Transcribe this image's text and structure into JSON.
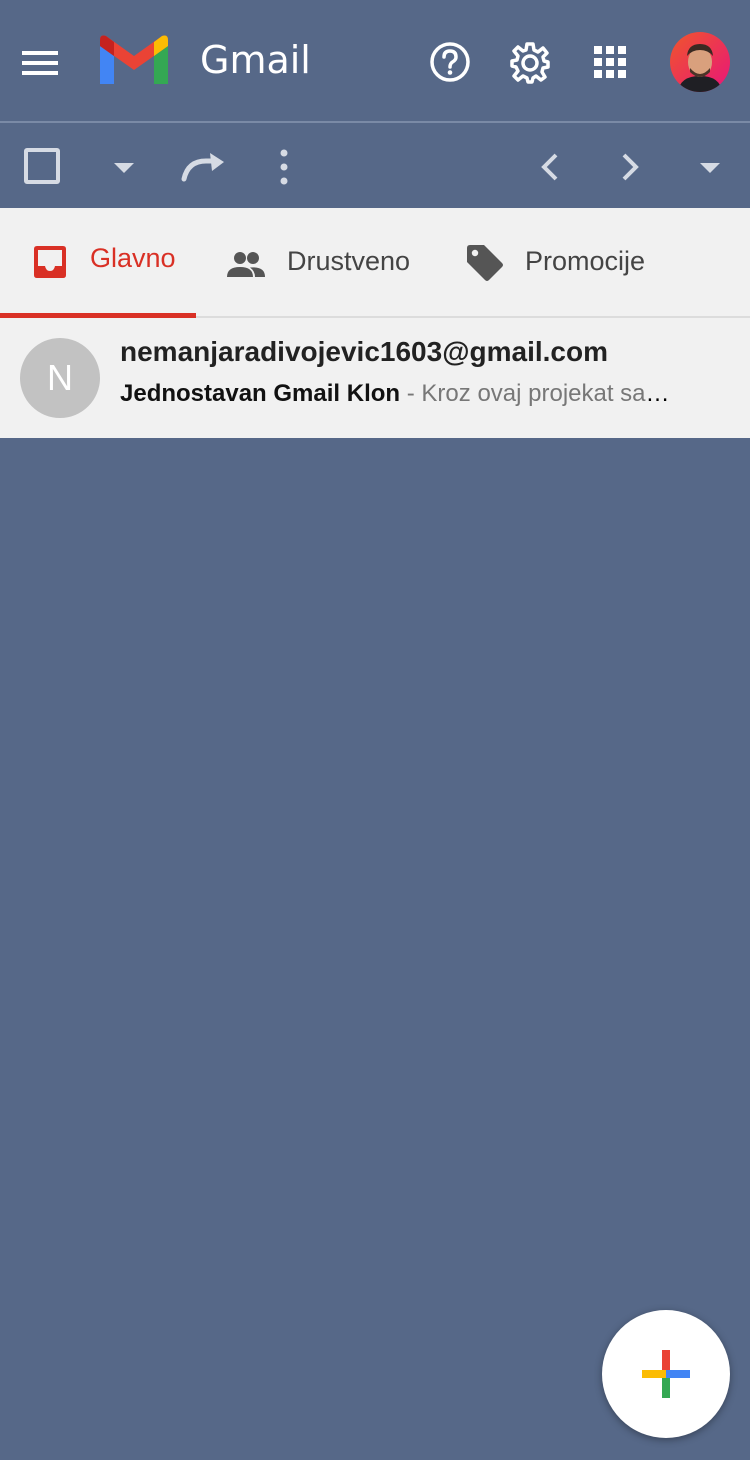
{
  "header": {
    "brand": "Gmail",
    "icons": [
      "menu-icon",
      "gmail-logo",
      "help-icon",
      "settings-icon",
      "apps-icon",
      "account-avatar"
    ]
  },
  "toolbar": {
    "icons": [
      "select-checkbox",
      "select-dropdown",
      "refresh-icon",
      "more-icon",
      "prev-page-icon",
      "next-page-icon",
      "dropdown-icon"
    ]
  },
  "tabs": [
    {
      "label": "Glavno",
      "icon": "inbox-icon",
      "active": true
    },
    {
      "label": "Drustveno",
      "icon": "people-icon",
      "active": false
    },
    {
      "label": "Promocije",
      "icon": "tag-icon",
      "active": false
    }
  ],
  "emails": [
    {
      "avatar_letter": "N",
      "sender": "nemanjaradivojevic1603@gmail.com",
      "subject": "Jednostavan Gmail Klon",
      "separator": "-",
      "snippet": "Kroz ovaj projekat sam naučio"
    }
  ],
  "colors": {
    "background": "#566888",
    "accent": "#d93025",
    "tabs_bg": "#f1f1f1"
  }
}
